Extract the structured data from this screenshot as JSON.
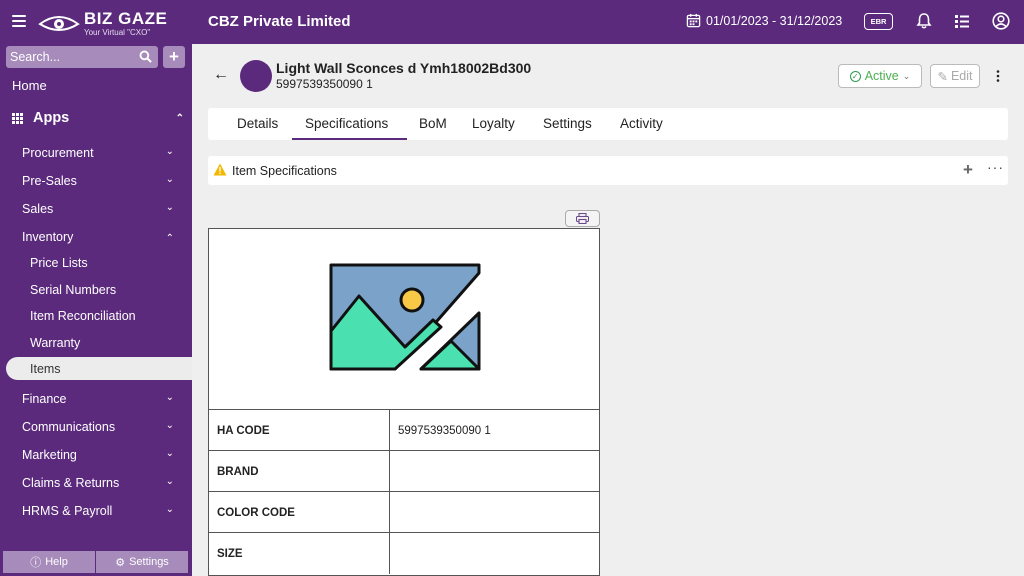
{
  "topbar": {
    "logo_name": "BIZ GAZE",
    "logo_tagline": "Your Virtual \"CXO\"",
    "company": "CBZ Private Limited",
    "date_range": "01/01/2023 - 31/12/2023",
    "ebr_label": "EBR",
    "icons": [
      "menu-icon",
      "calendar-icon",
      "bell-icon",
      "list-icon",
      "user-icon"
    ]
  },
  "sidebar": {
    "search_placeholder": "Search...",
    "add_label": "+",
    "home": "Home",
    "apps": "Apps",
    "modules": [
      {
        "label": "Procurement"
      },
      {
        "label": "Pre-Sales"
      },
      {
        "label": "Sales"
      },
      {
        "label": "Inventory"
      }
    ],
    "inventory_items": [
      {
        "label": "Price Lists"
      },
      {
        "label": "Serial Numbers"
      },
      {
        "label": "Item Reconciliation"
      },
      {
        "label": "Warranty"
      },
      {
        "label": "Items"
      }
    ],
    "modules_after": [
      {
        "label": "Finance"
      },
      {
        "label": "Communications"
      },
      {
        "label": "Marketing"
      },
      {
        "label": "Claims & Returns"
      },
      {
        "label": "HRMS & Payroll"
      }
    ],
    "help_label": "Help",
    "settings_label": "Settings"
  },
  "item": {
    "title": "Light Wall Sconces d Ymh18002Bd300",
    "code": "5997539350090 1",
    "status": "Active",
    "edit_label": "Edit"
  },
  "tabs": [
    {
      "label": "Details"
    },
    {
      "label": "Specifications",
      "active": true
    },
    {
      "label": "BoM"
    },
    {
      "label": "Loyalty"
    },
    {
      "label": "Settings"
    },
    {
      "label": "Activity"
    }
  ],
  "specs": {
    "section_title": "Item Specifications",
    "plus_label": "+",
    "more_label": "···",
    "rows": [
      {
        "key": "HA CODE",
        "value": "5997539350090 1"
      },
      {
        "key": "BRAND",
        "value": ""
      },
      {
        "key": "COLOR CODE",
        "value": ""
      },
      {
        "key": "SIZE",
        "value": ""
      }
    ]
  },
  "colors": {
    "brand_purple": "#5b2a7c",
    "sidebar_highlight": "#a68bbb",
    "status_green": "#2e9b4f",
    "warning_yellow": "#f5b800"
  }
}
